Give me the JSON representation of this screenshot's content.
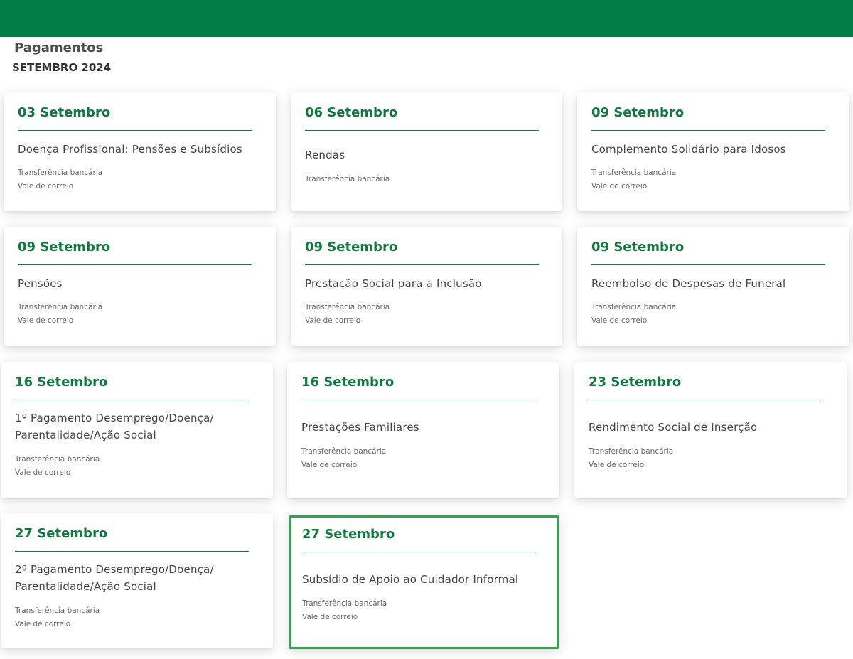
{
  "header": {
    "title": "Pagamentos",
    "subtitle": "SETEMBRO 2024",
    "brand_color": "#007e45"
  },
  "cards": [
    {
      "date": "03 Setembro",
      "title_lines": [
        "Doença Profissional: Pensões e Subsídios"
      ],
      "methods": [
        "Transferência bancária",
        "Vale de correio"
      ]
    },
    {
      "date": "06 Setembro",
      "title_lines": [
        "Rendas"
      ],
      "methods": [
        "Transferência bancária"
      ]
    },
    {
      "date": "09 Setembro",
      "title_lines": [
        "Complemento Solidário para Idosos"
      ],
      "methods": [
        "Transferência bancária",
        "Vale de correio"
      ]
    },
    {
      "date": "09 Setembro",
      "title_lines": [
        "Pensões"
      ],
      "methods": [
        "Transferência bancária",
        "Vale de correio"
      ]
    },
    {
      "date": "09 Setembro",
      "title_lines": [
        "Prestação Social para a Inclusão"
      ],
      "methods": [
        "Transferência bancária",
        "Vale de correio"
      ]
    },
    {
      "date": "09 Setembro",
      "title_lines": [
        "Reembolso de Despesas de Funeral"
      ],
      "methods": [
        "Transferência bancária",
        "Vale de correio"
      ]
    },
    {
      "date": "16 Setembro",
      "title_lines": [
        "1º Pagamento Desemprego/Doença/",
        "Parentalidade/Ação Social"
      ],
      "methods": [
        "Transferência bancária",
        "Vale de correio"
      ]
    },
    {
      "date": "16 Setembro",
      "title_lines": [
        "Prestações Familiares"
      ],
      "methods": [
        "Transferência bancária",
        "Vale de correio"
      ]
    },
    {
      "date": "23 Setembro",
      "title_lines": [
        "Rendimento Social de Inserção"
      ],
      "methods": [
        "Transferência bancária",
        "Vale de correio"
      ]
    },
    {
      "date": "27 Setembro",
      "title_lines": [
        "2º Pagamento Desemprego/Doença/",
        "Parentalidade/Ação Social"
      ],
      "methods": [
        "Transferência bancária",
        "Vale de correio"
      ]
    },
    {
      "date": "27 Setembro",
      "title_lines": [
        "Subsídio de Apoio ao Cuidador Informal"
      ],
      "methods": [
        "Transferência bancária",
        "Vale de correio"
      ],
      "highlighted": true,
      "highlight_color": "#2ea84f"
    }
  ]
}
